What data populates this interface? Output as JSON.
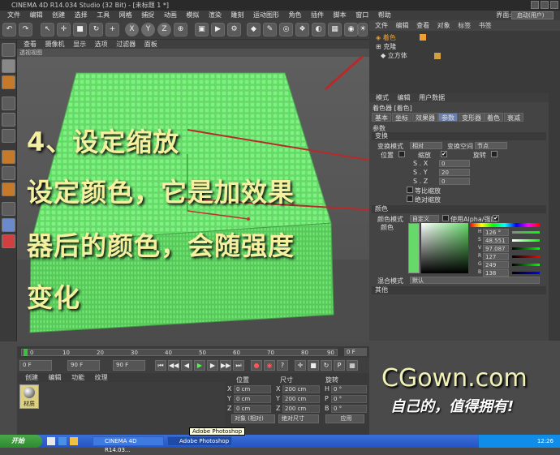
{
  "window": {
    "title": "CINEMA 4D R14.034 Studio (32 Bit) - [未标题 1 *]"
  },
  "menu": {
    "items": [
      "文件",
      "编辑",
      "创建",
      "选择",
      "工具",
      "网格",
      "捕捉",
      "动画",
      "模拟",
      "渲染",
      "雕刻",
      "运动图形",
      "角色",
      "插件",
      "脚本",
      "窗口",
      "帮助"
    ],
    "interface_label": "界面:",
    "interface_value": "启动(用户)"
  },
  "toolbar": {
    "axis_x": "X",
    "axis_y": "Y",
    "axis_z": "Z"
  },
  "viewport": {
    "menu": [
      "查看",
      "摄像机",
      "显示",
      "选项",
      "过滤器",
      "面板"
    ],
    "name": "透视视图",
    "cube_color": "#67d96a",
    "overlay_lines": [
      "4、设定缩放",
      "设定颜色，它是加效果",
      "器后的颜色，会随强度",
      "变化"
    ]
  },
  "timeline": {
    "ticks": [
      "0",
      "10",
      "20",
      "30",
      "40",
      "50",
      "60",
      "70",
      "80",
      "90"
    ],
    "current_frame": "0 F",
    "start_field": "0 F",
    "end_field": "90 F",
    "end_field2": "90 F"
  },
  "material_manager": {
    "menu": [
      "创建",
      "编辑",
      "功能",
      "纹理"
    ],
    "material_name": "材质"
  },
  "coordinates": {
    "headers": [
      "位置",
      "尺寸",
      "旋转"
    ],
    "rows": [
      {
        "axis": "X",
        "pos": "0 cm",
        "size": "200 cm",
        "rot_axis": "H",
        "rot": "0 °"
      },
      {
        "axis": "Y",
        "pos": "0 cm",
        "size": "200 cm",
        "rot_axis": "P",
        "rot": "0 °"
      },
      {
        "axis": "Z",
        "pos": "0 cm",
        "size": "200 cm",
        "rot_axis": "B",
        "rot": "0 °"
      }
    ],
    "mode1": "对象 (相对)",
    "mode2": "绝对尺寸",
    "apply": "应用"
  },
  "object_manager": {
    "menu": [
      "文件",
      "编辑",
      "查看",
      "对象",
      "标签",
      "书签"
    ],
    "objects": [
      "着色",
      "克隆",
      "立方体"
    ]
  },
  "attributes": {
    "menu": [
      "模式",
      "编辑",
      "用户数据"
    ],
    "title": "着色器 [着色]",
    "tabs": [
      "基本",
      "坐标",
      "效果器",
      "参数",
      "变形器",
      "着色",
      "衰减"
    ],
    "active_tab": "参数",
    "section_params": "参数",
    "section_transform": "变换",
    "transform_mode_label": "变换模式",
    "transform_mode": "相对",
    "transform_space_label": "变换空间",
    "transform_space": "节点",
    "position_label": "位置",
    "scale_label": "缩放",
    "rotation_label": "旋转",
    "sx_label": "S . X",
    "sx": "0",
    "sy_label": "S . Y",
    "sy": "20",
    "sz_label": "S . Z",
    "sz": "0",
    "uniform_label": "等比缩放",
    "absolute_label": "绝对缩放",
    "section_color": "颜色",
    "color_mode_label": "颜色模式",
    "color_mode": "自定义",
    "use_alpha": "使用Alpha/强度",
    "color_label": "颜色",
    "color_value": "#67d96a",
    "hsv": [
      {
        "k": "H",
        "v": "126 °"
      },
      {
        "k": "S",
        "v": "48.551 %"
      },
      {
        "k": "V",
        "v": "97.087 %"
      }
    ],
    "rgb": [
      {
        "k": "R",
        "v": "127"
      },
      {
        "k": "G",
        "v": "249"
      },
      {
        "k": "B",
        "v": "138"
      }
    ],
    "blend_label": "混合模式",
    "blend_mode": "默认",
    "section_other": "其他"
  },
  "watermark": {
    "title": "CGown.com",
    "subtitle": "自己的，值得拥有!"
  },
  "taskbar": {
    "start": "开始",
    "tasks": [
      "CINEMA 4D R14.03...",
      "Adobe Photoshop"
    ],
    "time": "12:26"
  },
  "tooltip": "Adobe Photoshop"
}
